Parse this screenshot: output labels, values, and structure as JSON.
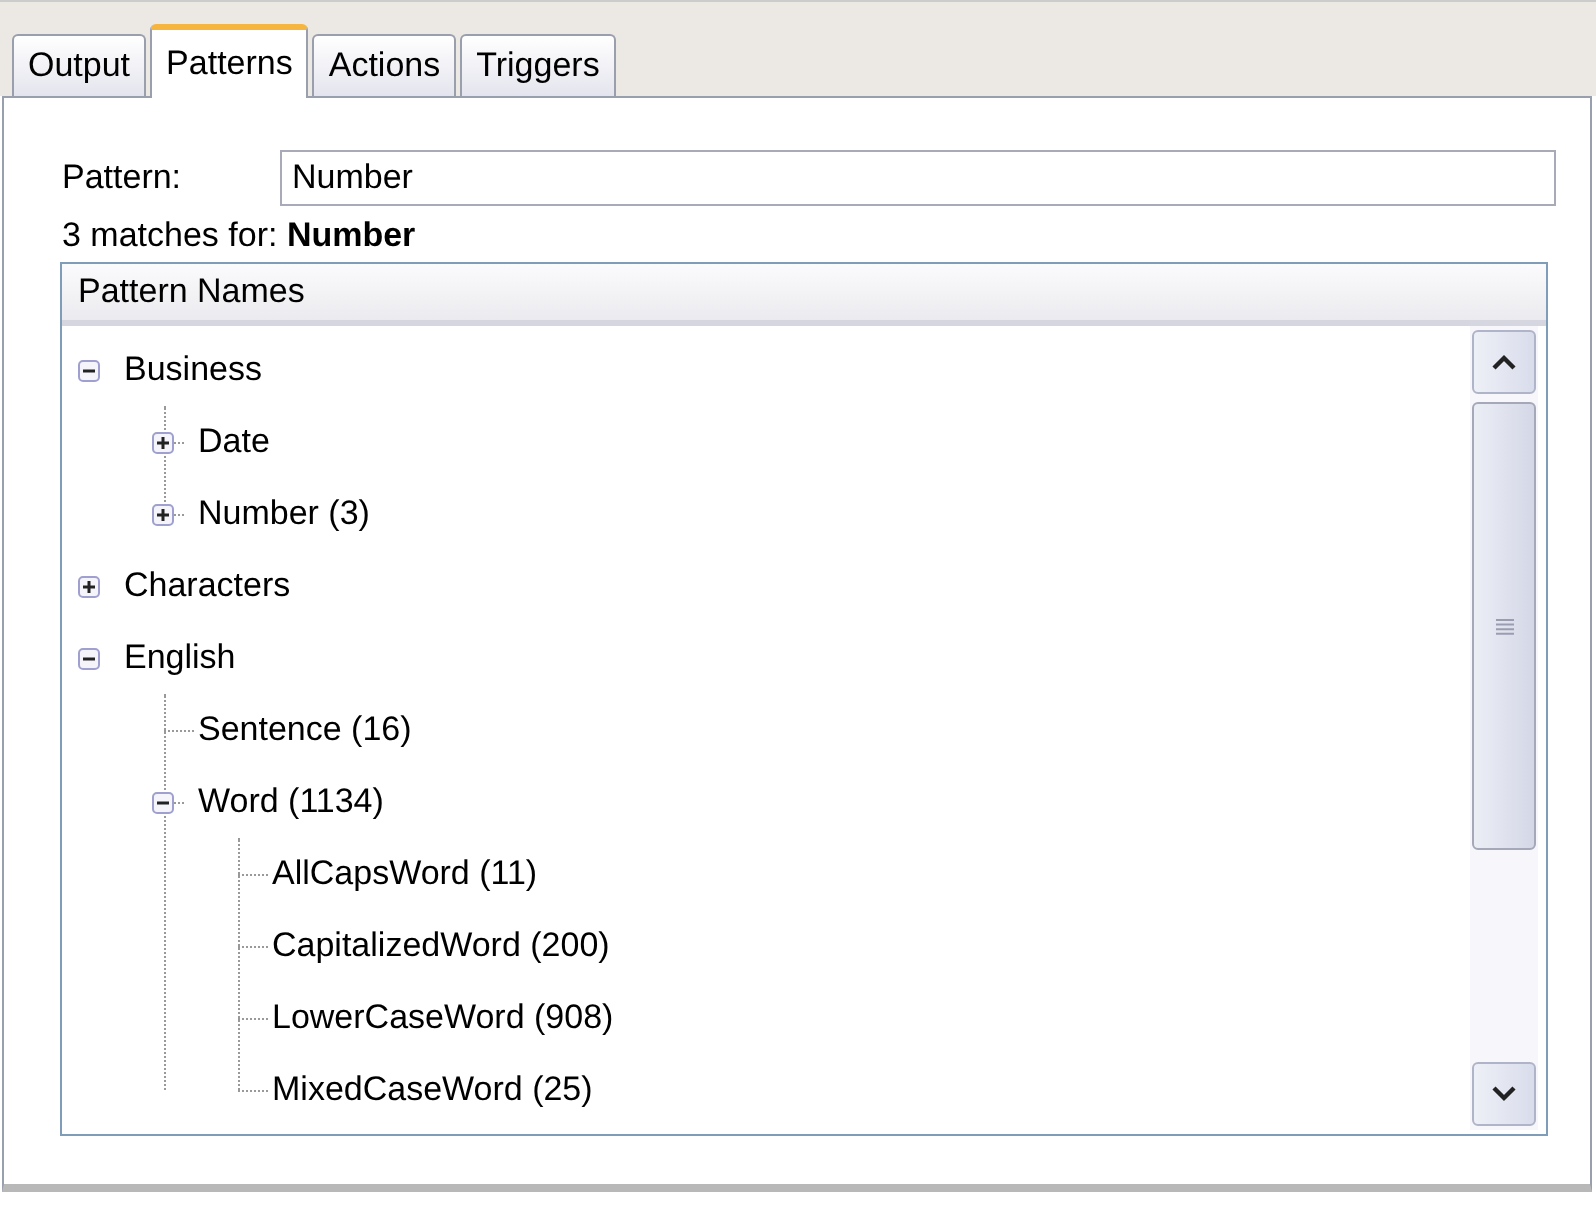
{
  "tabs": [
    {
      "label": "Output",
      "selected": false
    },
    {
      "label": "Patterns",
      "selected": true
    },
    {
      "label": "Actions",
      "selected": false
    },
    {
      "label": "Triggers",
      "selected": false
    }
  ],
  "pattern_field": {
    "label": "Pattern:",
    "value": "Number"
  },
  "match_summary": "3 matches for: **Number**",
  "tree": {
    "column": "Pattern Names",
    "items": [
      {
        "label": "Business",
        "kind": "group",
        "expanded": true,
        "children": [
          {
            "label": "Date",
            "kind": "group",
            "expanded": false
          },
          {
            "label": "Number (3)",
            "kind": "group",
            "expanded": false
          }
        ]
      },
      {
        "label": "Characters",
        "kind": "group",
        "expanded": false
      },
      {
        "label": "English",
        "kind": "group",
        "expanded": true,
        "children": [
          {
            "label": "Sentence (16)",
            "kind": "leaf"
          },
          {
            "label": "Word (1134)",
            "kind": "group",
            "expanded": true,
            "children": [
              {
                "label": "AllCapsWord (11)",
                "kind": "leaf"
              },
              {
                "label": "CapitalizedWord (200)",
                "kind": "leaf"
              },
              {
                "label": "LowerCaseWord (908)",
                "kind": "leaf"
              },
              {
                "label": "MixedCaseWord (25)",
                "kind": "leaf"
              }
            ]
          }
        ]
      }
    ]
  }
}
